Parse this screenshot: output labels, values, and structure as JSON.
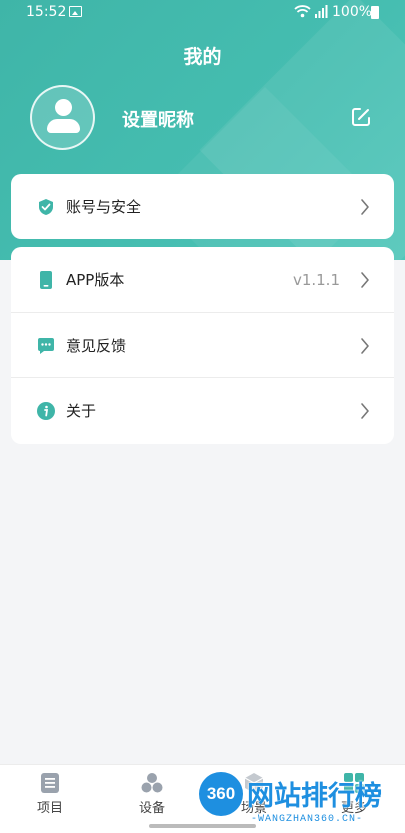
{
  "status_bar": {
    "time": "15:52",
    "battery": "100%"
  },
  "header": {
    "title": "我的",
    "nickname": "设置昵称"
  },
  "menu": {
    "account_security": "账号与安全",
    "app_version_label": "APP版本",
    "app_version_value": "v1.1.1",
    "feedback": "意见反馈",
    "about": "关于"
  },
  "tabbar": {
    "projects": "项目",
    "devices": "设备",
    "scenes": "场景",
    "more": "更多"
  },
  "watermark": {
    "badge": "360",
    "title": "网站排行榜",
    "subtitle": "-WANGZHAN360.CN-"
  },
  "colors": {
    "brand": "#3fb5a8",
    "page_bg": "#f4f5f7",
    "watermark_blue": "#1e8fe0"
  },
  "icons": {
    "status_image": "image-icon",
    "wifi": "wifi-icon",
    "signal": "signal-icon",
    "battery": "battery-icon",
    "edit": "edit-icon",
    "account_security": "shield-check-icon",
    "app_version": "phone-icon",
    "feedback": "chat-bubble-icon",
    "about": "info-icon",
    "chevron": "chevron-right-icon",
    "projects": "list-icon",
    "devices": "cubes-icon",
    "scenes": "cube-icon",
    "more": "grid-icon"
  }
}
